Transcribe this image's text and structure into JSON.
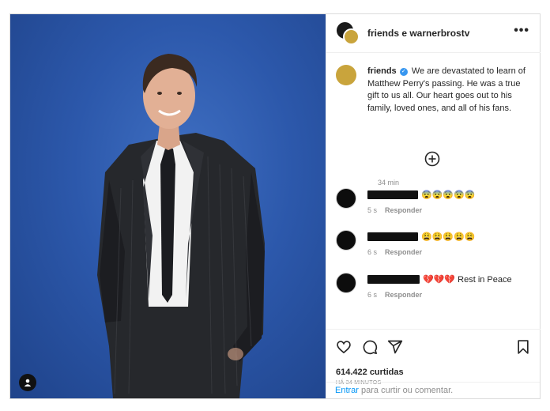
{
  "header": {
    "title": "friends e warnerbrostv",
    "more_label": "•••"
  },
  "caption": {
    "username": "friends",
    "text": "We are devastated to learn of Matthew Perry's passing. He was a true gift to us all. Our heart goes out to his family, loved ones, and all of his fans.",
    "time": "34 min"
  },
  "comments": [
    {
      "text": "😨😨😨😨😨",
      "time": "5 s",
      "reply": "Responder"
    },
    {
      "text": "😩😩😩😩😩",
      "time": "6 s",
      "reply": "Responder"
    },
    {
      "text": "💔💔💔 Rest in Peace",
      "time": "6 s",
      "reply": "Responder"
    }
  ],
  "likes": "614.422 curtidas",
  "posted_ago": "HÁ 34 MINUTOS",
  "login_prompt": {
    "link": "Entrar",
    "rest": " para curtir ou comentar."
  },
  "colors": {
    "accent": "#0095f6",
    "verified": "#3897f0",
    "photo_bg": "#2c58ab"
  },
  "icons": [
    "heart-icon",
    "comment-icon",
    "share-icon",
    "bookmark-icon",
    "add-circle-icon",
    "user-tag-icon",
    "more-icon"
  ]
}
